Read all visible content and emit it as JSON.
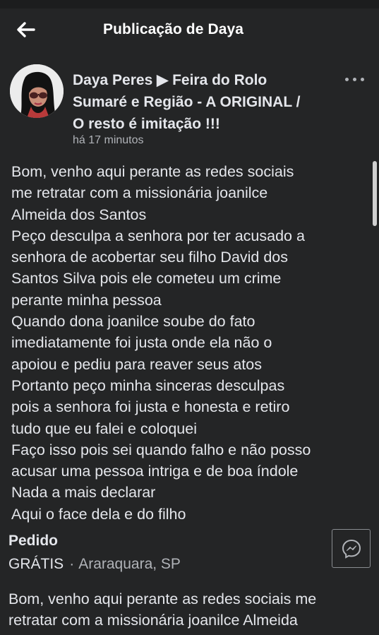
{
  "header": {
    "back_icon": "back-arrow-icon",
    "title": "Publicação de Daya"
  },
  "post": {
    "author_line1": "Daya Peres ▶ Feira do Rolo",
    "author_line2": "Sumaré e Região - A ORIGINAL /",
    "author_line3": "O resto é imitação !!!",
    "time": "há 17 minutos",
    "more_icon": "more-options-icon",
    "body_lines": [
      "Bom, venho aqui perante as redes sociais",
      "me retratar com a missionária joanilce",
      "Almeida dos Santos",
      "Peço desculpa a senhora por ter acusado a",
      "senhora de acobertar seu filho David dos",
      "Santos Silva  pois ele cometeu um crime",
      "perante minha pessoa",
      "Quando dona joanilce soube do fato",
      "imediatamente foi justa onde ela não o",
      "apoiou e pediu para reaver seus atos",
      "Portanto peço minha sinceras desculpas",
      "pois a senhora foi justa e honesta e retiro",
      "tudo que eu falei e coloquei",
      "Faço isso pois sei quando falho e não posso",
      "acusar uma pessoa intriga e de boa índole",
      "Nada a mais declarar",
      "Aqui o face dela  e do filho"
    ]
  },
  "listing": {
    "title": "Pedido",
    "price": "GRÁTIS",
    "separator": "·",
    "location": "Araraquara, SP",
    "messenger_icon": "messenger-icon"
  },
  "description": {
    "lines": [
      "Bom, venho aqui perante as redes sociais me",
      "retratar com a missionária joanilce Almeida"
    ]
  }
}
